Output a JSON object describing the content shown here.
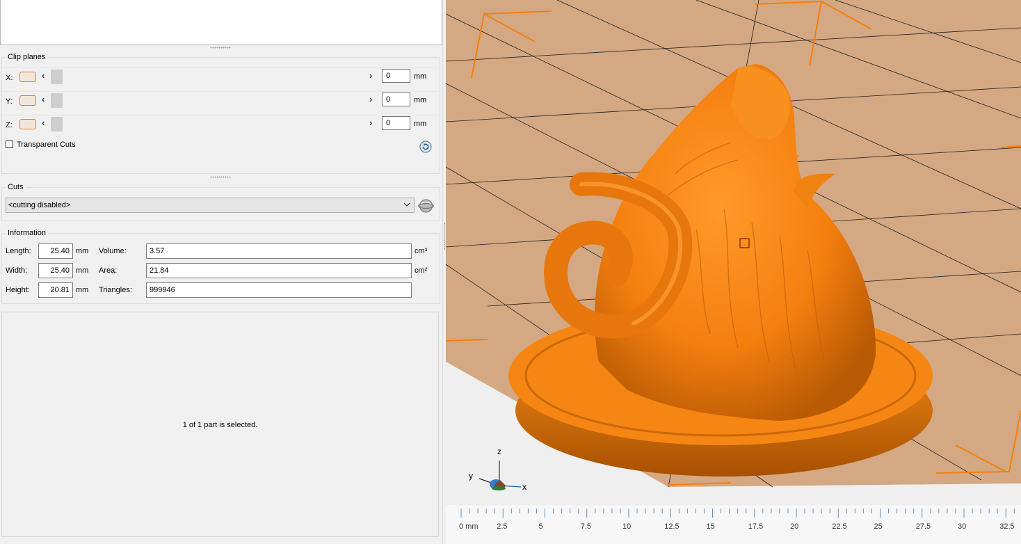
{
  "clip_planes": {
    "title": "Clip planes",
    "rows": [
      {
        "axis": "X:",
        "value": "0",
        "unit": "mm"
      },
      {
        "axis": "Y:",
        "value": "0",
        "unit": "mm"
      },
      {
        "axis": "Z:",
        "value": "0",
        "unit": "mm"
      }
    ],
    "prev_glyph": "‹",
    "next_glyph": "›",
    "transparent_cuts_label": "Transparent Cuts",
    "transparent_cuts_checked": false
  },
  "cuts": {
    "title": "Cuts",
    "selected": "<cutting disabled>"
  },
  "information": {
    "title": "Information",
    "length_label": "Length:",
    "length_value": "25.40",
    "length_unit": "mm",
    "width_label": "Width:",
    "width_value": "25.40",
    "width_unit": "mm",
    "height_label": "Height:",
    "height_value": "20.81",
    "height_unit": "mm",
    "volume_label": "Volume:",
    "volume_value": "3.57",
    "volume_unit": "cm³",
    "area_label": "Area:",
    "area_value": "21.84",
    "area_unit": "cm²",
    "triangles_label": "Triangles:",
    "triangles_value": "999946"
  },
  "status": {
    "selection_text": "1 of 1 part is selected."
  },
  "viewport": {
    "model_color": "#f47f0f",
    "build_plate_color": "#d4a882",
    "axis_labels": {
      "z": "z",
      "y": "y",
      "x": "x"
    },
    "ruler": {
      "unit_label": "0 mm",
      "ticks": [
        "2.5",
        "5",
        "7.5",
        "10",
        "12.5",
        "15",
        "17.5",
        "20",
        "22.5",
        "25",
        "27.5",
        "30",
        "32.5"
      ]
    }
  }
}
